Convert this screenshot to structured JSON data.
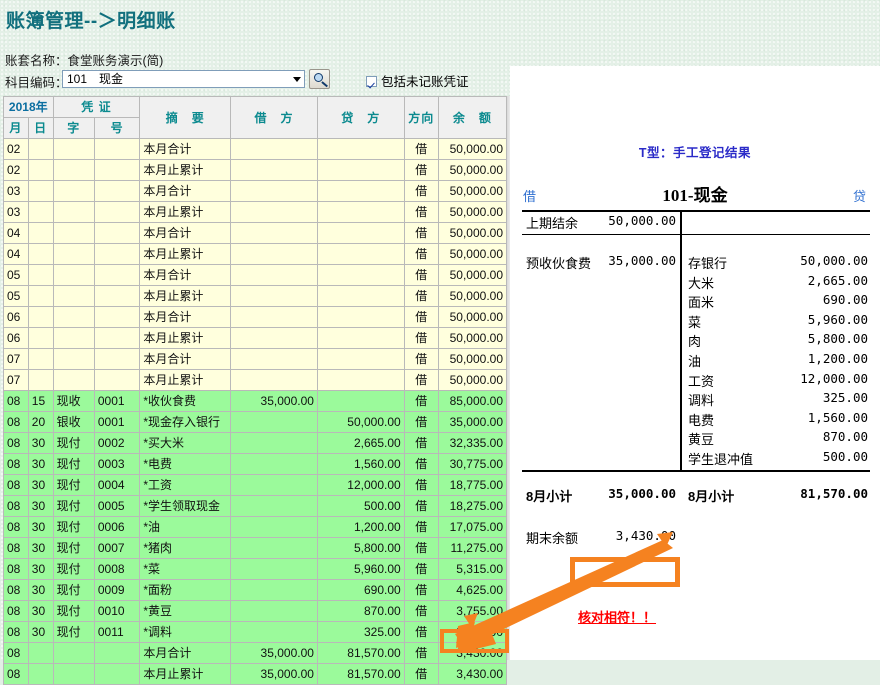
{
  "window": {
    "title": "账簿管理--＞明细账",
    "title_color": "#12707e",
    "background_color": "#e4f0e7"
  },
  "toolbar": {
    "book_label": "账套名称：",
    "book_value": "食堂账务演示(简)",
    "subject_label": "科目编码：",
    "subject_value": "101　现金",
    "find_icon": "magnifier-search-icon",
    "include_unposted_label": "包括未记账凭证",
    "include_unposted_checked": true
  },
  "ledger": {
    "year_header": "2018年",
    "voucher_header": "凭 证",
    "columns": [
      "月",
      "日",
      "字",
      "号",
      "摘　要",
      "借　方",
      "贷　方",
      "方向",
      "余　额"
    ],
    "row_bg_normal": "#ffffdd",
    "row_bg_green": "#9bfa9b",
    "rows": [
      {
        "m": "02",
        "d": "",
        "z": "",
        "h": "",
        "summary": "本月合计",
        "debit": "",
        "credit": "",
        "dir": "借",
        "balance": "50,000.00",
        "green": false
      },
      {
        "m": "02",
        "d": "",
        "z": "",
        "h": "",
        "summary": "本月止累计",
        "debit": "",
        "credit": "",
        "dir": "借",
        "balance": "50,000.00",
        "green": false
      },
      {
        "m": "03",
        "d": "",
        "z": "",
        "h": "",
        "summary": "本月合计",
        "debit": "",
        "credit": "",
        "dir": "借",
        "balance": "50,000.00",
        "green": false
      },
      {
        "m": "03",
        "d": "",
        "z": "",
        "h": "",
        "summary": "本月止累计",
        "debit": "",
        "credit": "",
        "dir": "借",
        "balance": "50,000.00",
        "green": false
      },
      {
        "m": "04",
        "d": "",
        "z": "",
        "h": "",
        "summary": "本月合计",
        "debit": "",
        "credit": "",
        "dir": "借",
        "balance": "50,000.00",
        "green": false
      },
      {
        "m": "04",
        "d": "",
        "z": "",
        "h": "",
        "summary": "本月止累计",
        "debit": "",
        "credit": "",
        "dir": "借",
        "balance": "50,000.00",
        "green": false
      },
      {
        "m": "05",
        "d": "",
        "z": "",
        "h": "",
        "summary": "本月合计",
        "debit": "",
        "credit": "",
        "dir": "借",
        "balance": "50,000.00",
        "green": false
      },
      {
        "m": "05",
        "d": "",
        "z": "",
        "h": "",
        "summary": "本月止累计",
        "debit": "",
        "credit": "",
        "dir": "借",
        "balance": "50,000.00",
        "green": false
      },
      {
        "m": "06",
        "d": "",
        "z": "",
        "h": "",
        "summary": "本月合计",
        "debit": "",
        "credit": "",
        "dir": "借",
        "balance": "50,000.00",
        "green": false
      },
      {
        "m": "06",
        "d": "",
        "z": "",
        "h": "",
        "summary": "本月止累计",
        "debit": "",
        "credit": "",
        "dir": "借",
        "balance": "50,000.00",
        "green": false
      },
      {
        "m": "07",
        "d": "",
        "z": "",
        "h": "",
        "summary": "本月合计",
        "debit": "",
        "credit": "",
        "dir": "借",
        "balance": "50,000.00",
        "green": false
      },
      {
        "m": "07",
        "d": "",
        "z": "",
        "h": "",
        "summary": "本月止累计",
        "debit": "",
        "credit": "",
        "dir": "借",
        "balance": "50,000.00",
        "green": false
      },
      {
        "m": "08",
        "d": "15",
        "z": "现收",
        "h": "0001",
        "summary": "*收伙食费",
        "debit": "35,000.00",
        "credit": "",
        "dir": "借",
        "balance": "85,000.00",
        "green": true
      },
      {
        "m": "08",
        "d": "20",
        "z": "银收",
        "h": "0001",
        "summary": "*现金存入银行",
        "debit": "",
        "credit": "50,000.00",
        "dir": "借",
        "balance": "35,000.00",
        "green": true
      },
      {
        "m": "08",
        "d": "30",
        "z": "现付",
        "h": "0002",
        "summary": "*买大米",
        "debit": "",
        "credit": "2,665.00",
        "dir": "借",
        "balance": "32,335.00",
        "green": true
      },
      {
        "m": "08",
        "d": "30",
        "z": "现付",
        "h": "0003",
        "summary": "*电费",
        "debit": "",
        "credit": "1,560.00",
        "dir": "借",
        "balance": "30,775.00",
        "green": true
      },
      {
        "m": "08",
        "d": "30",
        "z": "现付",
        "h": "0004",
        "summary": "*工资",
        "debit": "",
        "credit": "12,000.00",
        "dir": "借",
        "balance": "18,775.00",
        "green": true
      },
      {
        "m": "08",
        "d": "30",
        "z": "现付",
        "h": "0005",
        "summary": "*学生领取现金",
        "debit": "",
        "credit": "500.00",
        "dir": "借",
        "balance": "18,275.00",
        "green": true
      },
      {
        "m": "08",
        "d": "30",
        "z": "现付",
        "h": "0006",
        "summary": "*油",
        "debit": "",
        "credit": "1,200.00",
        "dir": "借",
        "balance": "17,075.00",
        "green": true
      },
      {
        "m": "08",
        "d": "30",
        "z": "现付",
        "h": "0007",
        "summary": "*猪肉",
        "debit": "",
        "credit": "5,800.00",
        "dir": "借",
        "balance": "11,275.00",
        "green": true
      },
      {
        "m": "08",
        "d": "30",
        "z": "现付",
        "h": "0008",
        "summary": "*菜",
        "debit": "",
        "credit": "5,960.00",
        "dir": "借",
        "balance": "5,315.00",
        "green": true
      },
      {
        "m": "08",
        "d": "30",
        "z": "现付",
        "h": "0009",
        "summary": "*面粉",
        "debit": "",
        "credit": "690.00",
        "dir": "借",
        "balance": "4,625.00",
        "green": true
      },
      {
        "m": "08",
        "d": "30",
        "z": "现付",
        "h": "0010",
        "summary": "*黄豆",
        "debit": "",
        "credit": "870.00",
        "dir": "借",
        "balance": "3,755.00",
        "green": true
      },
      {
        "m": "08",
        "d": "30",
        "z": "现付",
        "h": "0011",
        "summary": "*调料",
        "debit": "",
        "credit": "325.00",
        "dir": "借",
        "balance": "3,430.00",
        "green": true
      },
      {
        "m": "08",
        "d": "",
        "z": "",
        "h": "",
        "summary": "本月合计",
        "debit": "35,000.00",
        "credit": "81,570.00",
        "dir": "借",
        "balance": "3,430.00",
        "green": true
      },
      {
        "m": "08",
        "d": "",
        "z": "",
        "h": "",
        "summary": "本月止累计",
        "debit": "35,000.00",
        "credit": "81,570.00",
        "dir": "借",
        "balance": "3,430.00",
        "green": true
      }
    ]
  },
  "t_account": {
    "caption": "T型：手工登记结果",
    "title": "101-现金",
    "debit_label": "借",
    "credit_label": "贷",
    "opening": {
      "name": "上期结余",
      "amount": "50,000.00"
    },
    "debit_entries": [
      {
        "name": "预收伙食费",
        "amount": "35,000.00"
      }
    ],
    "credit_entries": [
      {
        "name": "存银行",
        "amount": "50,000.00"
      },
      {
        "name": "大米",
        "amount": "2,665.00"
      },
      {
        "name": "面米",
        "amount": "690.00"
      },
      {
        "name": "菜",
        "amount": "5,960.00"
      },
      {
        "name": "肉",
        "amount": "5,800.00"
      },
      {
        "name": "油",
        "amount": "1,200.00"
      },
      {
        "name": "工资",
        "amount": "12,000.00"
      },
      {
        "name": "调料",
        "amount": "325.00"
      },
      {
        "name": "电费",
        "amount": "1,560.00"
      },
      {
        "name": "黄豆",
        "amount": "870.00"
      },
      {
        "name": "学生退冲值",
        "amount": "500.00"
      }
    ],
    "debit_subtotal": {
      "name": "8月小计",
      "amount": "35,000.00"
    },
    "credit_subtotal": {
      "name": "8月小计",
      "amount": "81,570.00"
    },
    "closing": {
      "name": "期末余额",
      "amount": "3,430.00"
    }
  },
  "annotations": {
    "highlight_color": "#f58220",
    "arrow_icon": "orange-arrow-icon",
    "note_text": "核对相符！！",
    "note_color": "#ff0000"
  }
}
